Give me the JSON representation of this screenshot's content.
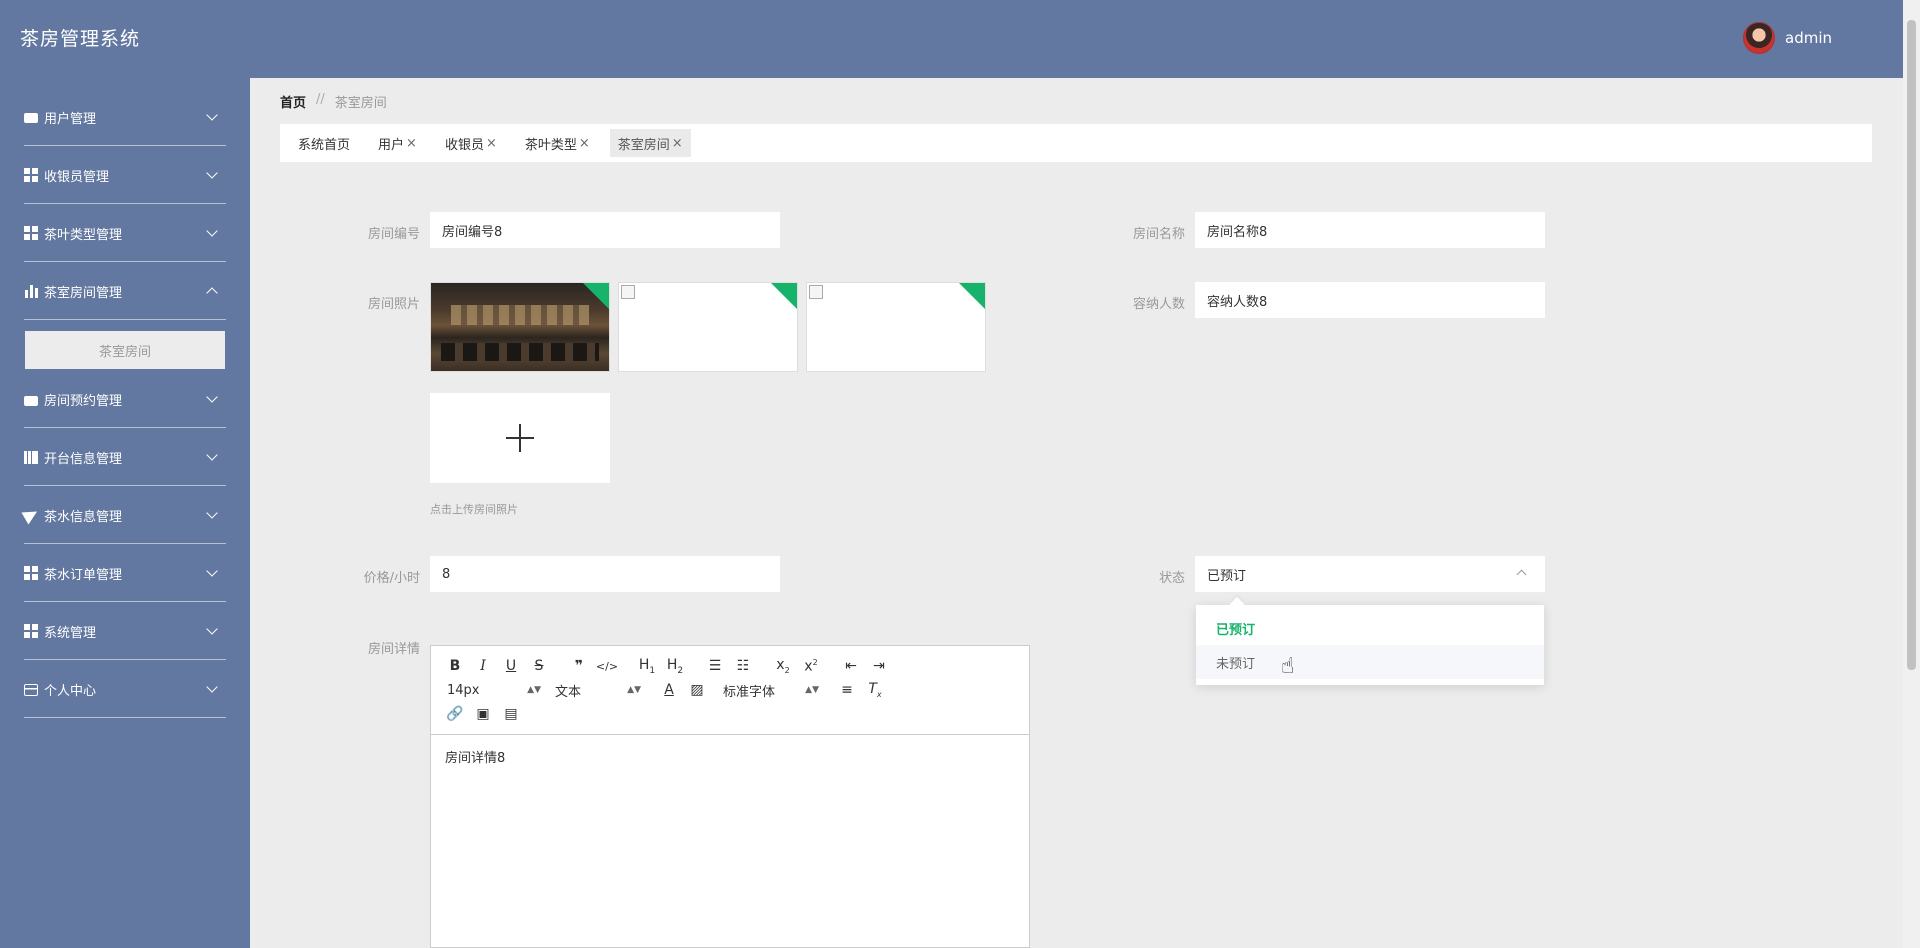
{
  "app": {
    "title": "茶房管理系统",
    "user": "admin"
  },
  "sidebar": {
    "items": [
      {
        "label": "用户管理",
        "icon": "chat-icon"
      },
      {
        "label": "收银员管理",
        "icon": "grid-icon"
      },
      {
        "label": "茶叶类型管理",
        "icon": "grid-icon"
      },
      {
        "label": "茶室房间管理",
        "icon": "bar-chart-icon"
      },
      {
        "label": "房间预约管理",
        "icon": "briefcase-icon"
      },
      {
        "label": "开台信息管理",
        "icon": "books-icon"
      },
      {
        "label": "茶水信息管理",
        "icon": "paper-plane-icon"
      },
      {
        "label": "茶水订单管理",
        "icon": "grid-icon"
      },
      {
        "label": "系统管理",
        "icon": "grid-icon"
      },
      {
        "label": "个人中心",
        "icon": "card-icon"
      }
    ],
    "sub_item": "茶室房间"
  },
  "breadcrumb": {
    "home": "首页",
    "sep": "//",
    "current": "茶室房间"
  },
  "tabs": [
    {
      "label": "系统首页",
      "close": ""
    },
    {
      "label": "用户",
      "close": "×"
    },
    {
      "label": "收银员",
      "close": "×"
    },
    {
      "label": "茶叶类型",
      "close": "×"
    },
    {
      "label": "茶室房间",
      "close": "×"
    }
  ],
  "form": {
    "room_no_label": "房间编号",
    "room_no_value": "房间编号8",
    "room_name_label": "房间名称",
    "room_name_value": "房间名称8",
    "photo_label": "房间照片",
    "capacity_label": "容纳人数",
    "capacity_value": "容纳人数8",
    "upload_hint": "点击上传房间照片",
    "price_label": "价格/小时",
    "price_value": "8",
    "status_label": "状态",
    "status_value": "已预订",
    "status_options": [
      "已预订",
      "未预订"
    ],
    "detail_label": "房间详情",
    "detail_value": "房间详情8"
  },
  "editor": {
    "font_size": "14px",
    "format": "文本",
    "font_family": "标准字体"
  },
  "colors": {
    "header": "#6378a0",
    "accent": "#17b36b"
  }
}
